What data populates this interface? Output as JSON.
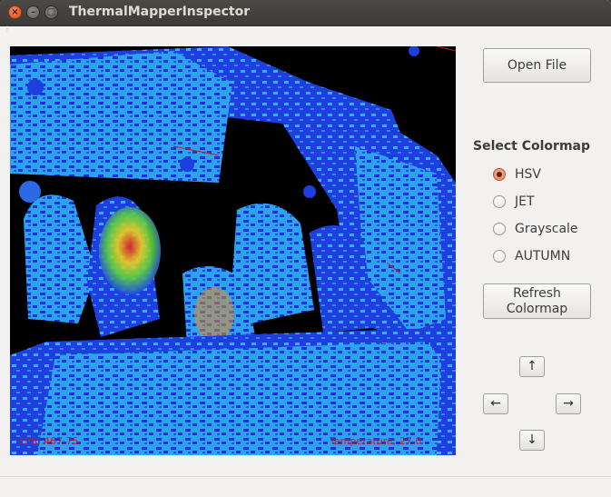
{
  "window": {
    "title": "ThermalMapperInspector",
    "controls": {
      "close": "×",
      "minimize": "–",
      "maximize": "□"
    }
  },
  "viewport": {
    "fps_text": "FPS: 467.75",
    "temperature_text": "Temperature: 27.0"
  },
  "sidebar": {
    "open_file_label": "Open File",
    "colormap_title": "Select Colormap",
    "colormaps": [
      {
        "label": "HSV",
        "selected": true
      },
      {
        "label": "JET",
        "selected": false
      },
      {
        "label": "Grayscale",
        "selected": false
      },
      {
        "label": "AUTUMN",
        "selected": false
      }
    ],
    "refresh_label_line1": "Refresh",
    "refresh_label_line2": "Colormap",
    "arrows": {
      "up": "↑",
      "left": "←",
      "right": "→",
      "down": "↓"
    }
  },
  "colors": {
    "hud_text": "#d21818",
    "radio_selected": "#f07e58",
    "scene_blue": "#1d3fe0",
    "scene_cyan": "#2ea7ea"
  },
  "icons": [
    "close-icon",
    "minimize-icon",
    "maximize-icon",
    "arrow-up-icon",
    "arrow-left-icon",
    "arrow-right-icon",
    "arrow-down-icon"
  ]
}
